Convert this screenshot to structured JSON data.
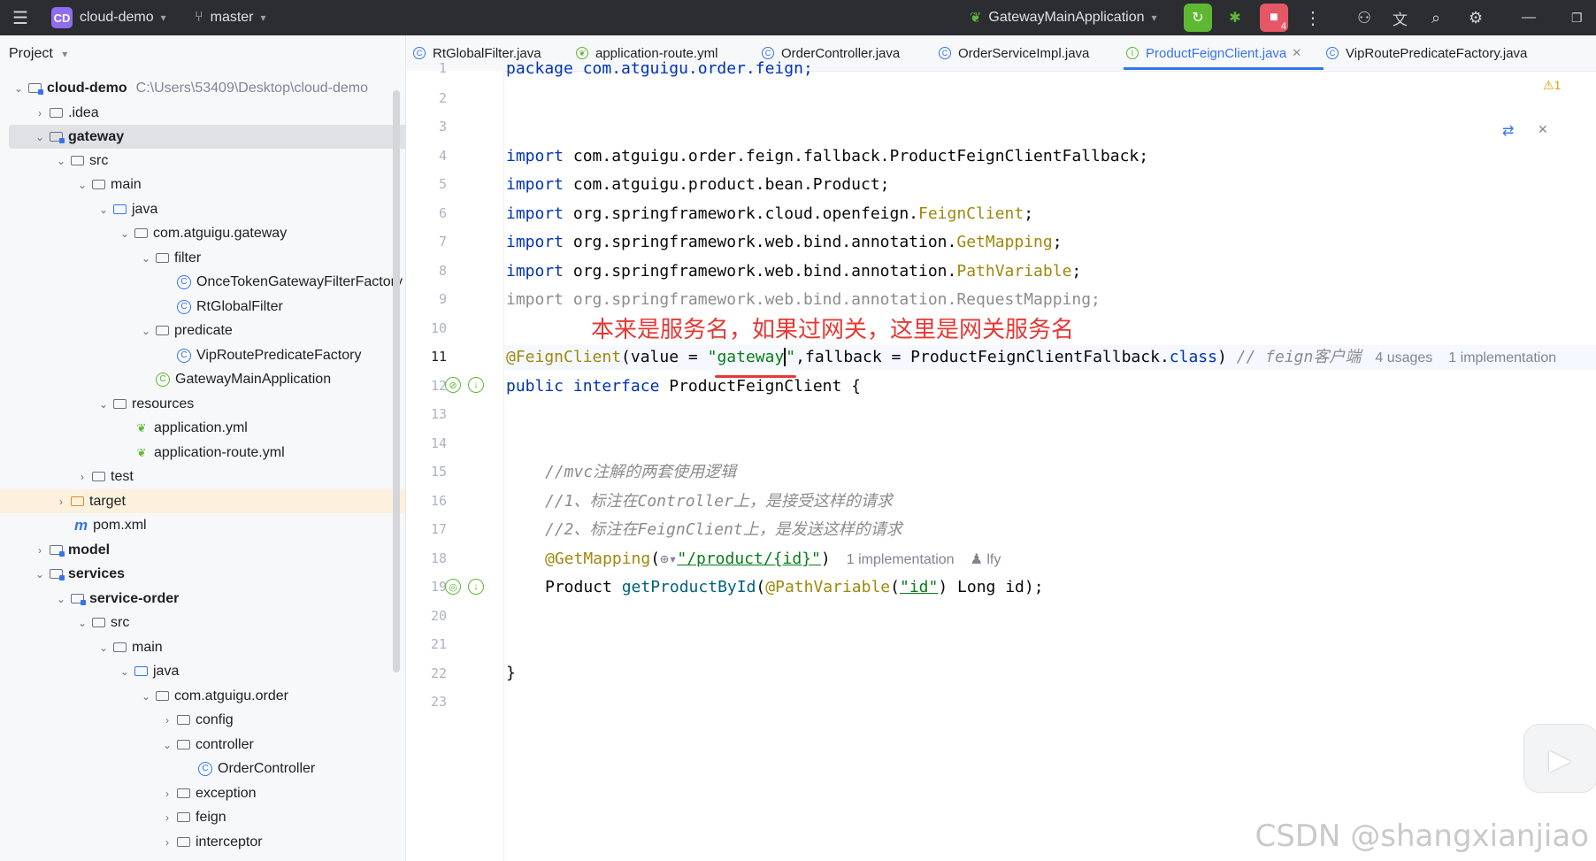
{
  "titlebar": {
    "project_badge": "CD",
    "project_name": "cloud-demo",
    "branch": "master",
    "run_config": "GatewayMainApplication",
    "stop_count": "4"
  },
  "sidebar": {
    "header": "Project",
    "rows": [
      {
        "label": "cloud-demo",
        "hint": "C:\\Users\\53409\\Desktop\\cloud-demo",
        "bold": true
      },
      {
        "label": ".idea"
      },
      {
        "label": "gateway",
        "bold": true
      },
      {
        "label": "src"
      },
      {
        "label": "main"
      },
      {
        "label": "java"
      },
      {
        "label": "com.atguigu.gateway"
      },
      {
        "label": "filter"
      },
      {
        "label": "OnceTokenGatewayFilterFactory"
      },
      {
        "label": "RtGlobalFilter"
      },
      {
        "label": "predicate"
      },
      {
        "label": "VipRoutePredicateFactory"
      },
      {
        "label": "GatewayMainApplication"
      },
      {
        "label": "resources"
      },
      {
        "label": "application.yml"
      },
      {
        "label": "application-route.yml"
      },
      {
        "label": "test"
      },
      {
        "label": "target"
      },
      {
        "label": "pom.xml"
      },
      {
        "label": "model",
        "bold": true
      },
      {
        "label": "services",
        "bold": true
      },
      {
        "label": "service-order",
        "bold": true
      },
      {
        "label": "src"
      },
      {
        "label": "main"
      },
      {
        "label": "java"
      },
      {
        "label": "com.atguigu.order"
      },
      {
        "label": "config"
      },
      {
        "label": "controller"
      },
      {
        "label": "OrderController"
      },
      {
        "label": "exception"
      },
      {
        "label": "feign"
      },
      {
        "label": "interceptor"
      }
    ]
  },
  "tabs": [
    {
      "label": "RtGlobalFilter.java"
    },
    {
      "label": "application-route.yml"
    },
    {
      "label": "OrderController.java"
    },
    {
      "label": "OrderServiceImpl.java"
    },
    {
      "label": "ProductFeignClient.java",
      "active": true
    },
    {
      "label": "VipRoutePredicateFactory.java"
    }
  ],
  "editor": {
    "warning_count": "1",
    "annotation_note": "本来是服务名，如果过网关，这里是网关服务名",
    "line_numbers": [
      "1",
      "2",
      "3",
      "4",
      "5",
      "6",
      "7",
      "8",
      "9",
      "10",
      "11",
      "12",
      "13",
      "14",
      "15",
      "16",
      "17",
      "18",
      "19",
      "20",
      "21",
      "22",
      "23"
    ],
    "line1": "package com.atguigu.order.feign;",
    "imports": {
      "kw": "import",
      "l4": " com.atguigu.order.feign.fallback.ProductFeignClientFallback;",
      "l5": " com.atguigu.product.bean.Product;",
      "l6a": " org.springframework.cloud.openfeign.",
      "l6b": "FeignClient",
      "l7a": " org.springframework.web.bind.annotation.",
      "l7b": "GetMapping",
      "l8a": " org.springframework.web.bind.annotation.",
      "l8b": "PathVariable",
      "l9": "import org.springframework.web.bind.annotation.RequestMapping;",
      "semi": ";"
    },
    "line11": {
      "ann": "@FeignClient",
      "p1": "(value = ",
      "q": "\"",
      "str": "gateway",
      "p2": ",fallback = ProductFeignClientFallback.",
      "cls_kw": "class",
      "p3": ") ",
      "cmt": "// feign客户端",
      "usages": "4 usages",
      "impls": "1 implementation"
    },
    "line12": {
      "kw1": "public",
      "kw2": "interface",
      "name": " ProductFeignClient {"
    },
    "line15": "//mvc注解的两套使用逻辑",
    "line16": "//1、标注在Controller上，是接受这样的请求",
    "line17": "//2、标注在FeignClient上，是发送这样的请求",
    "line18": {
      "ann": "@GetMapping",
      "p1": "(",
      "str": "\"/product/{id}\"",
      "p2": ")",
      "impl": "1 implementation",
      "author": "lfy"
    },
    "line19": {
      "p1": "Product ",
      "method": "getProductById",
      "p2": "(",
      "ann": "@PathVariable",
      "p3": "(",
      "str": "\"id\"",
      "p4": ") Long id);"
    },
    "line22": "}"
  },
  "watermark": "CSDN @shangxianjiao"
}
